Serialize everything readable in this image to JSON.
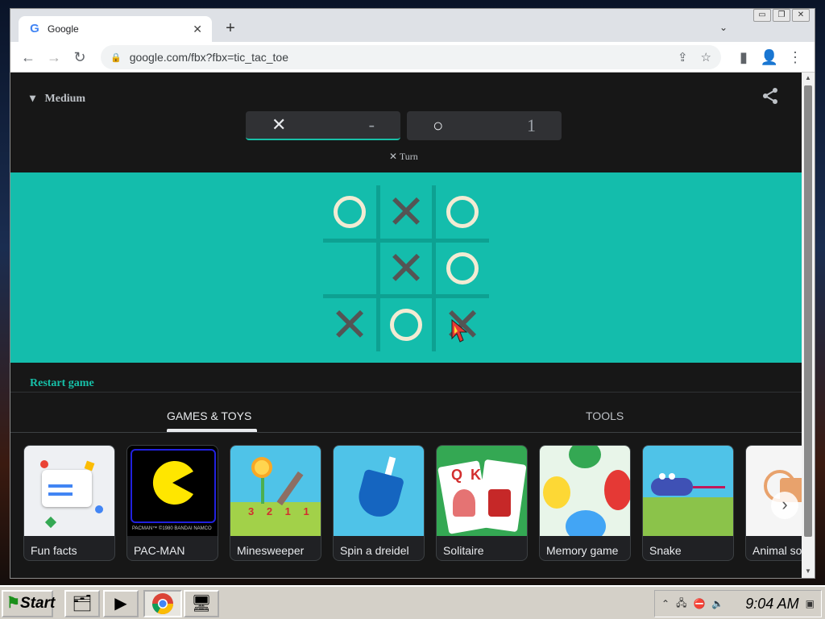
{
  "window": {
    "controls": [
      "▭",
      "❐",
      "✕"
    ]
  },
  "tab": {
    "title": "Google",
    "close": "✕",
    "new_tab": "+",
    "search_tabs": "⌄"
  },
  "toolbar": {
    "back": "←",
    "forward": "→",
    "reload": "↻",
    "lock": "🔒",
    "url": "google.com/fbx?fbx=tic_tac_toe",
    "share": "⇪",
    "star": "☆",
    "sidepanel": "▮",
    "profile": "👤",
    "menu": "⋮"
  },
  "game": {
    "difficulty": "Medium",
    "difficulty_arrow": "▾",
    "share_icon": "⋖",
    "score": [
      {
        "mark": "✕",
        "value": "-"
      },
      {
        "mark": "○",
        "value": "1"
      }
    ],
    "turn_mark": "✕",
    "turn_label": "Turn",
    "board": [
      "O",
      "X",
      "O",
      "",
      "X",
      "O",
      "X",
      "O",
      "X"
    ],
    "restart": "Restart game",
    "accent_color": "#17c0a8",
    "board_color": "#14bdac"
  },
  "tabs": {
    "games": "GAMES & TOYS",
    "tools": "TOOLS"
  },
  "cards": [
    {
      "label": "Fun facts"
    },
    {
      "label": "PAC-MAN",
      "caption": "PACMAN™ ©1980 BANDAI NAMCO"
    },
    {
      "label": "Minesweeper",
      "numbers": "3 2 1 1"
    },
    {
      "label": "Spin a dreidel"
    },
    {
      "label": "Solitaire",
      "cards": "Q  K"
    },
    {
      "label": "Memory game"
    },
    {
      "label": "Snake"
    },
    {
      "label": "Animal sounds"
    }
  ],
  "next": "›",
  "taskbar": {
    "start": "Start",
    "clock": "9:04 AM"
  }
}
